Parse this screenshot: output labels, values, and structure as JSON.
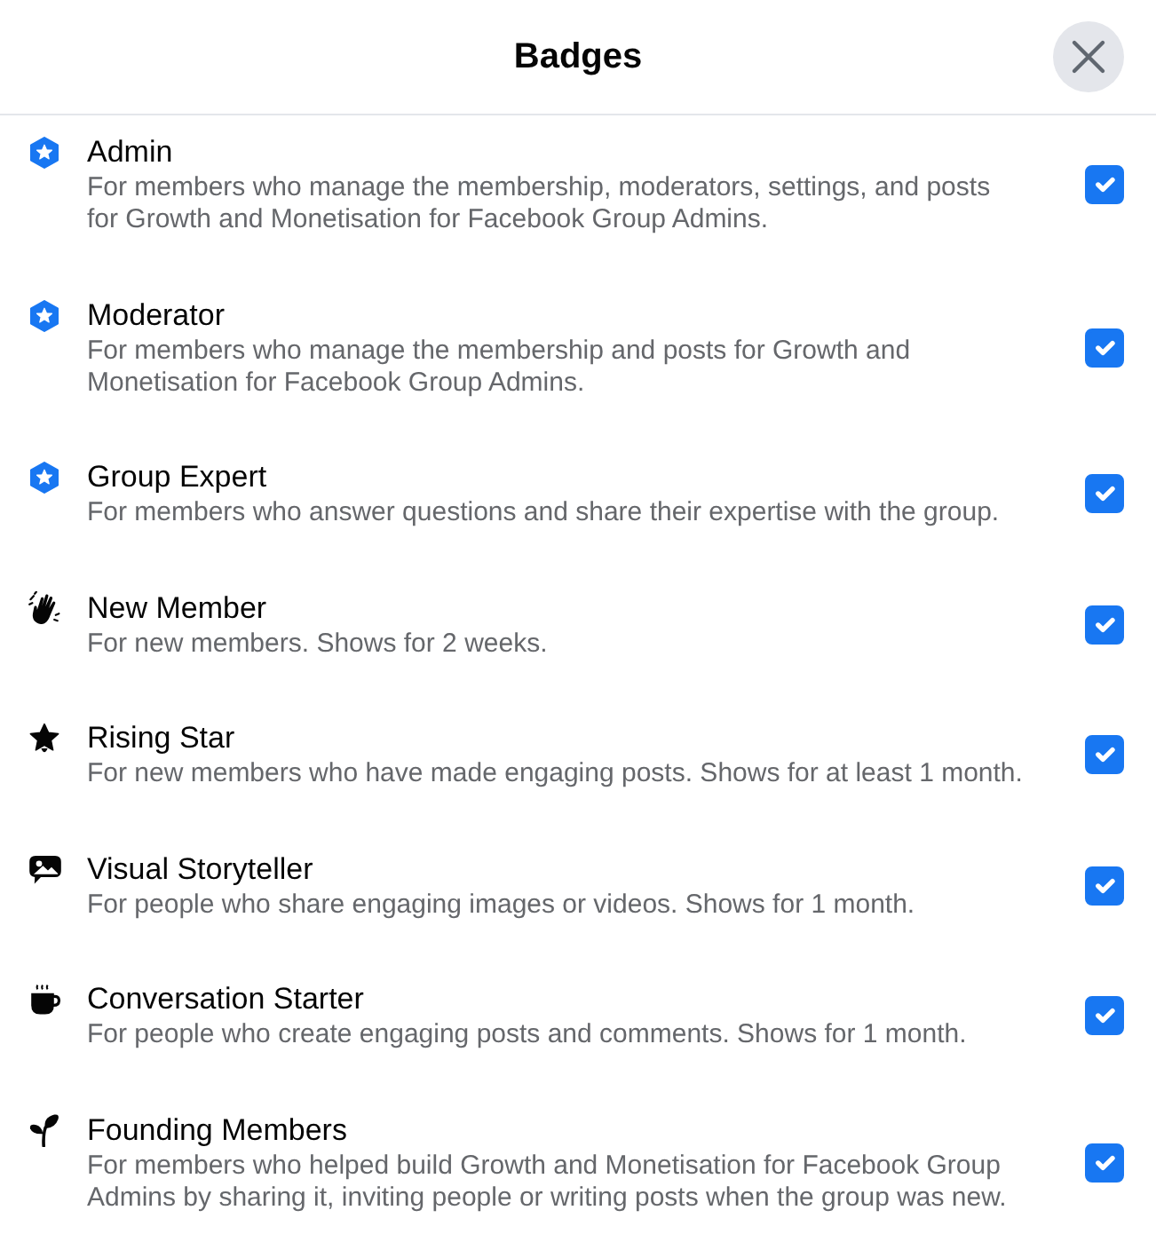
{
  "dialog": {
    "title": "Badges"
  },
  "badges": [
    {
      "kind": "role",
      "name": "Admin",
      "description": "For members who manage the membership, moderators, settings, and posts for Growth and Monetisation for Facebook Group Admins.",
      "checked": true
    },
    {
      "kind": "role",
      "name": "Moderator",
      "description": "For members who manage the membership and posts for Growth and Monetisation for Facebook Group Admins.",
      "checked": true
    },
    {
      "kind": "role",
      "name": "Group Expert",
      "description": "For members who answer questions and share their expertise with the group.",
      "checked": true
    },
    {
      "kind": "hand",
      "name": "New Member",
      "description": "For new members. Shows for 2 weeks.",
      "checked": true
    },
    {
      "kind": "star",
      "name": "Rising Star",
      "description": "For new members who have made engaging posts. Shows for at least 1 month.",
      "checked": true
    },
    {
      "kind": "bubble",
      "name": "Visual Storyteller",
      "description": "For people who share engaging images or videos. Shows for 1 month.",
      "checked": true
    },
    {
      "kind": "cup",
      "name": "Conversation Starter",
      "description": "For people who create engaging posts and comments. Shows for 1 month.",
      "checked": true
    },
    {
      "kind": "sprout",
      "name": "Founding Members",
      "description": "For members who helped build Growth and Monetisation for Facebook Group Admins by sharing it, inviting people or writing posts when the group was new.",
      "checked": true
    }
  ]
}
